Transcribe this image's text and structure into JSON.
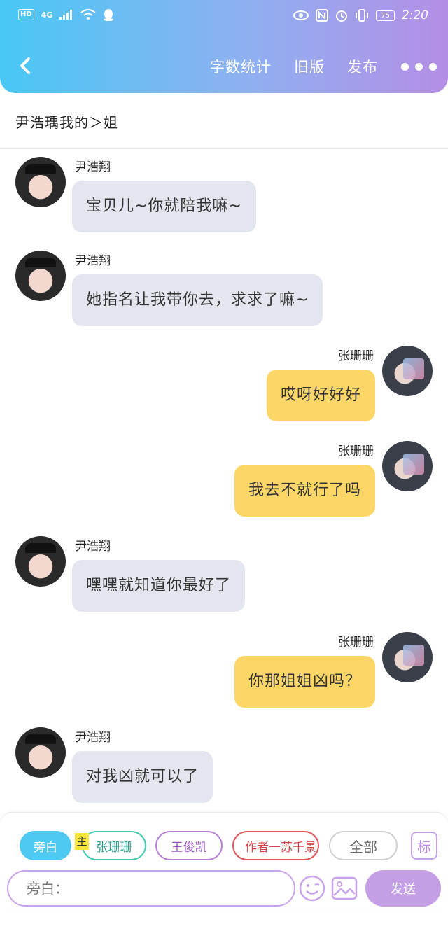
{
  "status_bar": {
    "hd": "HD",
    "network": "4G",
    "battery": "75",
    "time": "2:20"
  },
  "header": {
    "back_icon": "chevron-left-icon",
    "links": [
      "字数统计",
      "旧版",
      "发布"
    ],
    "more_icon": "more-dots-icon"
  },
  "chat": {
    "title": "尹浩瑀我的＞姐"
  },
  "messages": [
    {
      "side": "left",
      "name": "尹浩翔",
      "text": "宝贝儿~你就陪我嘛~"
    },
    {
      "side": "left",
      "name": "尹浩翔",
      "text": "她指名让我带你去，求求了嘛~"
    },
    {
      "side": "right",
      "name": "张珊珊",
      "text": "哎呀好好好"
    },
    {
      "side": "right",
      "name": "张珊珊",
      "text": "我去不就行了吗"
    },
    {
      "side": "left",
      "name": "尹浩翔",
      "text": "嘿嘿就知道你最好了"
    },
    {
      "side": "right",
      "name": "张珊珊",
      "text": "你那姐姐凶吗？"
    },
    {
      "side": "left",
      "name": "尹浩翔",
      "text": "对我凶就可以了"
    }
  ],
  "composer": {
    "roles": [
      "旁白",
      "张珊珊",
      "王俊凯",
      "作者一苏千景",
      "全部"
    ],
    "main_tag": "主",
    "tag_button": "标",
    "input_placeholder": "旁白：",
    "emoji_icon": "smiley-icon",
    "image_icon": "image-icon",
    "send_label": "发送"
  },
  "colors": {
    "header_gradient_start": "#48c8f5",
    "header_gradient_end": "#b48ee6",
    "bubble_left": "#e3e6ee",
    "bubble_right": "#fcd767",
    "send_button": "#c49fe6",
    "narrator_chip": "#4fc8f2"
  }
}
